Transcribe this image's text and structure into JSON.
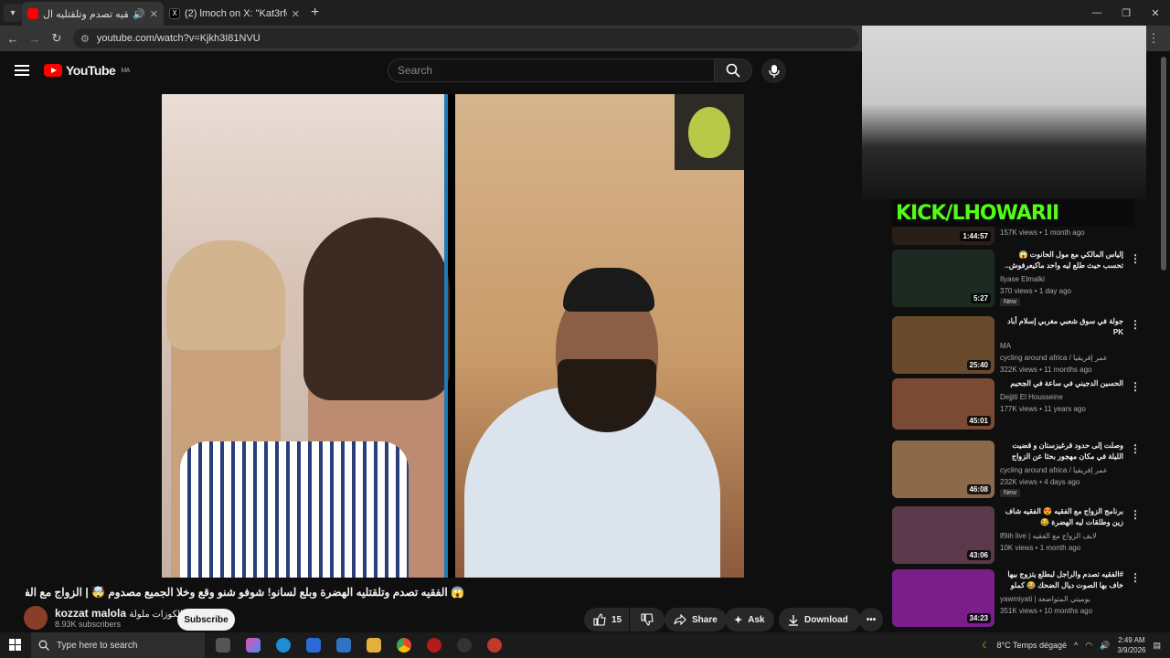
{
  "browser": {
    "tabs": [
      {
        "title": "الفقيه تصدم وتلقتليه ال",
        "active": true
      },
      {
        "title": "(2) lmoch on X: \"Kat3rfo tsawbo",
        "active": false
      }
    ],
    "url": "youtube.com/watch?v=Kjkh3I81NVU"
  },
  "youtube": {
    "logo_text": "YouTube",
    "region": "MA",
    "search_placeholder": "Search"
  },
  "video": {
    "title": "😱 الفقيه تصدم وتلقتليه الهضرة وبلع لسانو! شوفو شنو وقع وخلا الجميع مصدوم 🤯 | الزواج مع الفقيه",
    "channel_name": "kozzat malola",
    "channel_subtitle": "الكوزات ملولة",
    "subscribers": "8.93K subscribers",
    "subscribe_label": "Subscribe",
    "likes": "15",
    "share_label": "Share",
    "ask_label": "Ask",
    "download_label": "Download"
  },
  "overlay": {
    "kick_text": "KICK/LHOWARII"
  },
  "recommendations": [
    {
      "title": "",
      "channel": "",
      "views": "157K views • 1 month ago",
      "duration": "1:44:57",
      "badge": "",
      "color": "#2a1f18"
    },
    {
      "title": "إلياس المالكي مع مول الحانوت 😱 تحسب حيث طلع ليه واحد ماكيعرفوش.. شنو وقع؟",
      "channel": "Ilyase Elmalki",
      "views": "370 views • 1 day ago",
      "duration": "5:27",
      "badge": "New",
      "color": "#1d2a22"
    },
    {
      "title": "جولة في سوق شعبي مغربي إسلام أباد PK",
      "channel": "MA",
      "views": "cycling around africa / عمر إفريقيا",
      "views2": "322K views • 11 months ago",
      "duration": "25:40",
      "badge": "",
      "color": "#6a4a2c"
    },
    {
      "title": "الحسين الدجيني في ساعة في الجحيم",
      "channel": "Dejjiti El Housseine",
      "views": "177K views • 11 years ago",
      "duration": "45:01",
      "badge": "",
      "color": "#7a4a35"
    },
    {
      "title": "وصلت إلى حدود قرغيزستان و قضيت الليلة في مكان مهجور بحثا عن الزواج الغريبة",
      "channel": "cycling around africa / عمر إفريقيا",
      "views": "232K views • 4 days ago",
      "duration": "46:08",
      "badge": "New",
      "color": "#8a6a4a"
    },
    {
      "title": "برنامج الزواج مع الفقيه 😍 الفقيه شاف زين وطلقات ليه الهضرة 😂",
      "channel": "lf9ih live | لايف الزواج مع الفقيه",
      "views": "10K views • 1 month ago",
      "duration": "43:06",
      "badge": "",
      "color": "#5a3a4a"
    },
    {
      "title": "#الفقيه تصدم والراجل لبطلع يتزوج بيها خاف بها الصوت ديال الضحك 😂 كملو الفيديو أسالة",
      "channel": "yawmiyati | يوميتي المتواضعة",
      "views": "351K views • 10 months ago",
      "duration": "34:23",
      "badge": "",
      "color": "#7a1f8a"
    }
  ],
  "taskbar": {
    "search_placeholder": "Type here to search",
    "weather": "8°C  Temps dégagé",
    "time": "2:49 AM",
    "date": "3/9/2026"
  }
}
